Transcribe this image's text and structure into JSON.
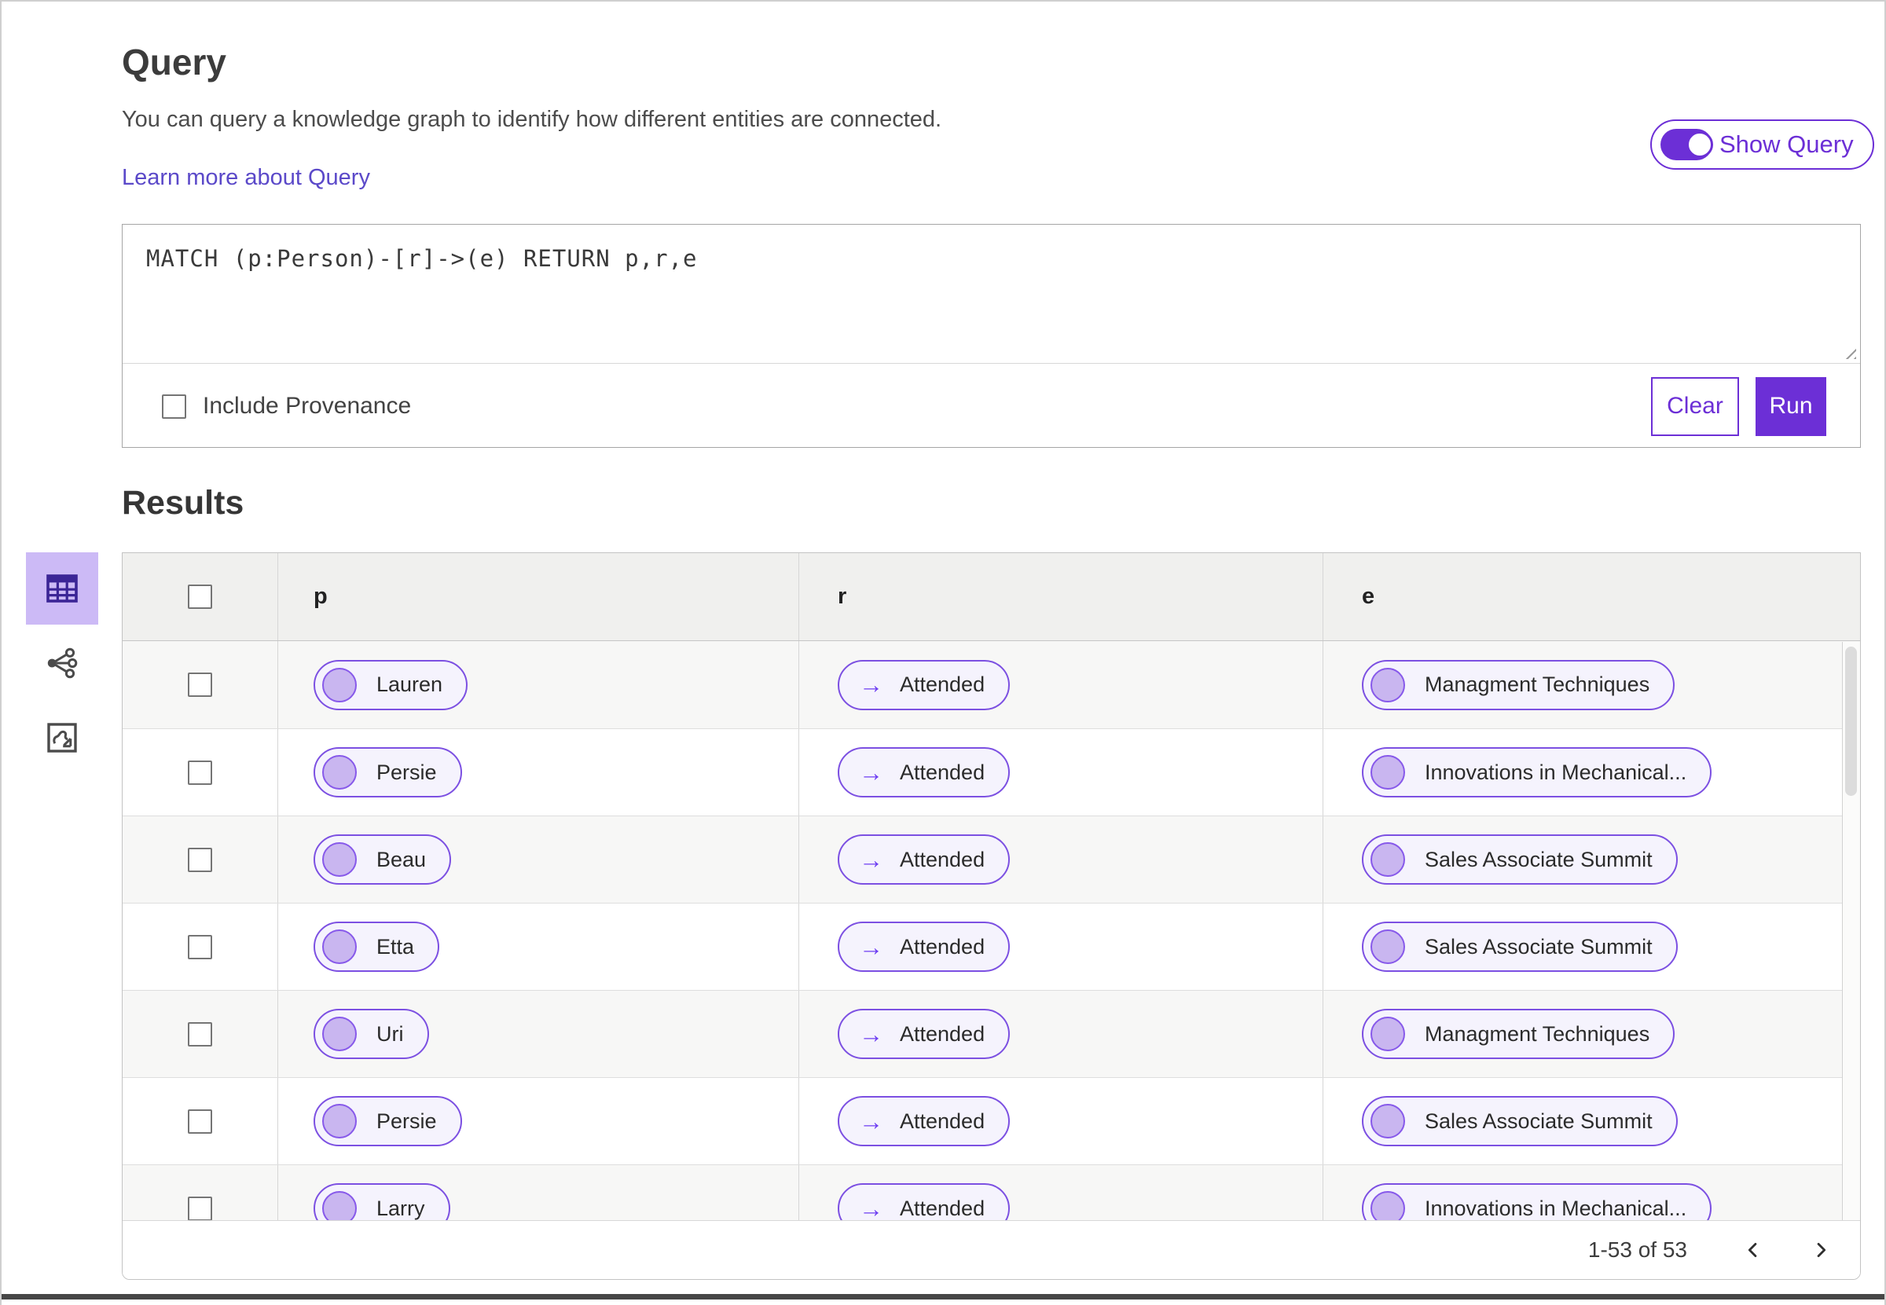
{
  "query_section": {
    "title": "Query",
    "description": "You can query a knowledge graph to identify how different entities are connected.",
    "learn_more": "Learn more about Query",
    "show_query_label": "Show Query",
    "show_query_on": true,
    "query_text": "MATCH (p:Person)-[r]->(e) RETURN p,r,e",
    "include_provenance_label": "Include Provenance",
    "include_provenance_checked": false,
    "clear_label": "Clear",
    "run_label": "Run"
  },
  "results_section": {
    "title": "Results",
    "view_switcher": [
      {
        "name": "table-view",
        "selected": true
      },
      {
        "name": "graph-view",
        "selected": false
      },
      {
        "name": "map-view",
        "selected": false
      }
    ],
    "table": {
      "columns": [
        "p",
        "r",
        "e"
      ],
      "relation_arrow": "→",
      "rows": [
        {
          "p": "Lauren",
          "r": "Attended",
          "e": "Managment Techniques"
        },
        {
          "p": "Persie",
          "r": "Attended",
          "e": "Innovations in Mechanical..."
        },
        {
          "p": "Beau",
          "r": "Attended",
          "e": "Sales Associate Summit"
        },
        {
          "p": "Etta",
          "r": "Attended",
          "e": "Sales Associate Summit"
        },
        {
          "p": "Uri",
          "r": "Attended",
          "e": "Managment Techniques"
        },
        {
          "p": "Persie",
          "r": "Attended",
          "e": "Sales Associate Summit"
        },
        {
          "p": "Larry",
          "r": "Attended",
          "e": "Innovations in Mechanical..."
        }
      ]
    },
    "pagination": {
      "range_text": "1-53 of 53"
    }
  },
  "colors": {
    "accent": "#6C2FD6",
    "accent_light": "#CCBAF6",
    "link": "#5B49C9",
    "pill_border": "#7C50E2",
    "pill_bg": "#F5F3FD",
    "node_fill": "#C9B6F0",
    "node_border": "#8759EA"
  }
}
